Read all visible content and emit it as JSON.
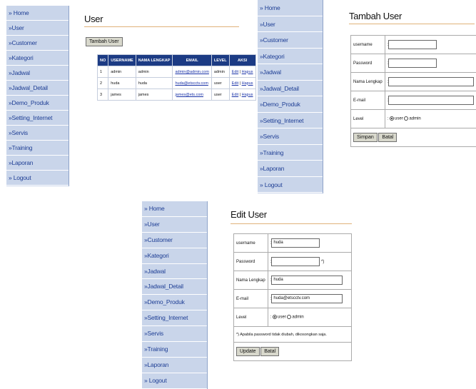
{
  "menu": [
    "» Home",
    "»User",
    "»Customer",
    "»Kategori",
    "»Jadwal",
    "»Jadwal_Detail",
    "»Demo_Produk",
    "»Setting_Internet",
    "»Servis",
    "»Training",
    "»Laporan",
    "» Logout"
  ],
  "user_page": {
    "title": "User",
    "add_button": "Tambah User",
    "columns": [
      "NO",
      "USERNAME",
      "NAMA LENGKAP",
      "EMAIL",
      "LEVEL",
      "AKSI"
    ],
    "rows": [
      {
        "no": "1",
        "username": "admin",
        "nama": "admin",
        "email": "admin@admin.com",
        "level": "admin"
      },
      {
        "no": "2",
        "username": "huda",
        "nama": "huda",
        "email": "huda@etscctv.com",
        "level": "user"
      },
      {
        "no": "3",
        "username": "james",
        "nama": "james",
        "email": "james@ets.com",
        "level": "user"
      }
    ],
    "edit_link": "Edit",
    "separator": " | ",
    "delete_link": "Hapus"
  },
  "add_page": {
    "title": "Tambah User",
    "labels": {
      "username": "username",
      "password": "Password",
      "nama": "Nama Lengkap",
      "email": "E-mail",
      "level": "Level"
    },
    "colon": ":",
    "radio_user": "user",
    "radio_admin": "admin",
    "save_button": "Simpan",
    "cancel_button": "Batal"
  },
  "edit_page": {
    "title": "Edit User",
    "labels": {
      "username": "username",
      "password": "Password",
      "nama": "Nama Lengkap",
      "email": "E-mail",
      "level": "Level"
    },
    "colon": ":",
    "values": {
      "username": "huda",
      "password": "",
      "nama": "huda",
      "email": "huda@etscctv.com"
    },
    "password_mark": "*)",
    "radio_user": "user",
    "radio_admin": "admin",
    "note": "*) Apabila password tidak diubah, dikosongkan saja.",
    "update_button": "Update",
    "cancel_button": "Batal"
  }
}
